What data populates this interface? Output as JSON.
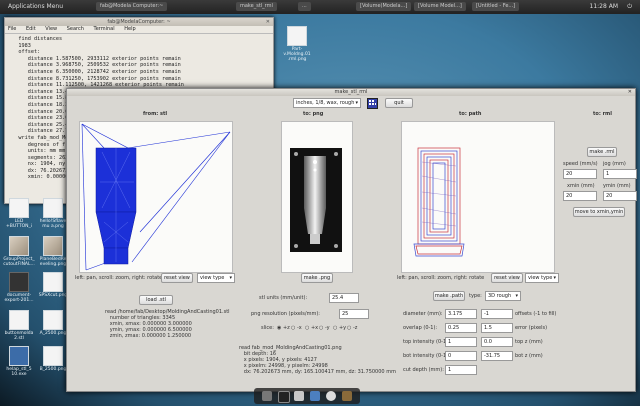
{
  "topbar": {
    "menu": "Applications Menu",
    "tasks": [
      "fab@Modela Computer:~",
      "make_stl_rml",
      "...",
      "[Volume(Modela...]",
      "[Volume Model...]",
      "[Untitled - Fe...]"
    ],
    "clock": "11:28 AM"
  },
  "terminal": {
    "title": "fab@ModelaComputer: ~",
    "menu": [
      "File",
      "Edit",
      "View",
      "Search",
      "Terminal",
      "Help"
    ],
    "lines": [
      "   find distances",
      "   1983",
      "   offset:",
      "      distance 1.587500, 2933112 exterior points remain",
      "      distance 3.968750, 2509532 exterior points remain",
      "      distance 6.350000, 2128742 exterior points remain",
      "      distance 8.731250, 1753902 exterior points remain",
      "      distance 11.112500, 1421268 exterior points remain",
      "      distance 13.4",
      "      distance 15.8",
      "      distance 18.2",
      "      distance 20.6",
      "      distance 23.0",
      "      distance 25.4",
      "      distance 27.7",
      "   write fab_mod_Molding",
      "      degrees of freedom",
      "      units: mm mm mm",
      "      segments: 262, poi",
      "      nx: 1904, ny: 4127",
      "      dx: 76.202673, dy:",
      "      xmin: 0.000000, y"
    ]
  },
  "desktop_icons": [
    {
      "label": "Part-v.Moldng.01 .rml.png",
      "style": "plain"
    },
    {
      "label": "LED +BUTTON_i",
      "style": "plain"
    },
    {
      "label": "hello!Sflave mu a.png",
      "style": "plain"
    },
    {
      "label": "GroupProject_ cutoutFINAL...",
      "style": "tex"
    },
    {
      "label": "PlaneBedRe eveling.png",
      "style": "tex"
    },
    {
      "label": "document- export-201...",
      "style": "dark"
    },
    {
      "label": "SPSXcut.png",
      "style": "plain"
    },
    {
      "label": "buttonmolda 2.stl",
      "style": "plain"
    },
    {
      "label": "A_2500.png",
      "style": "plain"
    },
    {
      "label": "helap_stl_5 10.exe",
      "style": "blue"
    },
    {
      "label": "B_2500.png",
      "style": "plain"
    }
  ],
  "window": {
    "title": "make_stl_rml",
    "units_select": "inches, 1/8, wax, rough",
    "quit": "quit",
    "stl": {
      "header": "from: stl",
      "hint": "left: pan, scroll: zoom, right: rotate",
      "reset_view": "reset view",
      "view_type": "view type",
      "load_button": "load .stl",
      "file_info": "read /home/fab/Desktop/MoldingAndCasting01.stl\n   number of triangles: 3345\n   xmin, xmax: 0.000000 3.000000\n   ymin, ymax: 0.000000 6.500000\n   zmin, zmax: 0.000000 1.250000"
    },
    "png": {
      "header": "to: png",
      "make_button": "make .png",
      "stl_units_label": "stl units (mm/unit):",
      "stl_units_value": "25.4",
      "resolution_label": "png resolution (pixels/mm):",
      "resolution_value": "25",
      "slice_label": "slice:",
      "slice_options": [
        "+z",
        "-x",
        "+x",
        "-y",
        "+y",
        "-z"
      ],
      "file_info": "read fab_mod_MoldingAndCasting01.png\n   bit depth: 16\n   x pixels: 1904, y pixels: 4127\n   x pixelm: 24998, y pixelm: 24998\n   dx: 76.202673 mm, dy: 165.100417 mm, dz: 31.750000 mm"
    },
    "path": {
      "header": "to: path",
      "hint": "left: pan, scroll: zoom, right: rotate",
      "reset_view": "reset view",
      "view_type": "view type",
      "make_button": "make .path",
      "type_label": "type:",
      "type_value": "3D rough",
      "rows": [
        {
          "label": "diameter (mm):",
          "value": "3.175",
          "value2": "-1",
          "label2": "offsets (-1 to fill)"
        },
        {
          "label": "overlap (0-1):",
          "value": "0.25",
          "value2": "1.5",
          "label2": "error (pixels)"
        },
        {
          "label": "top intensity (0-1):",
          "value": "1",
          "value2": "0.0",
          "label2": "top z (mm)"
        },
        {
          "label": "bot intensity (0-1):",
          "value": "0",
          "value2": "-31.75",
          "label2": "bot z (mm)"
        },
        {
          "label": "cut depth (mm):",
          "value": "1",
          "value2": "",
          "label2": ""
        }
      ]
    },
    "rml": {
      "header": "to: rml",
      "make_button": "make .rml",
      "speed_label": "speed (mm/s)",
      "jog_label": "jog (mm)",
      "speed_value": "20",
      "jog_value": "1",
      "xmin_label": "xmin (mm)",
      "ymin_label": "ymin (mm)",
      "xmin_value": "20",
      "ymin_value": "20",
      "move_button": "move to xmin,ymin"
    }
  },
  "colors": {
    "mesh": "#1a2cd6",
    "toolpath_red": "#c8323c",
    "toolpath_blue": "#3a4ad0"
  }
}
